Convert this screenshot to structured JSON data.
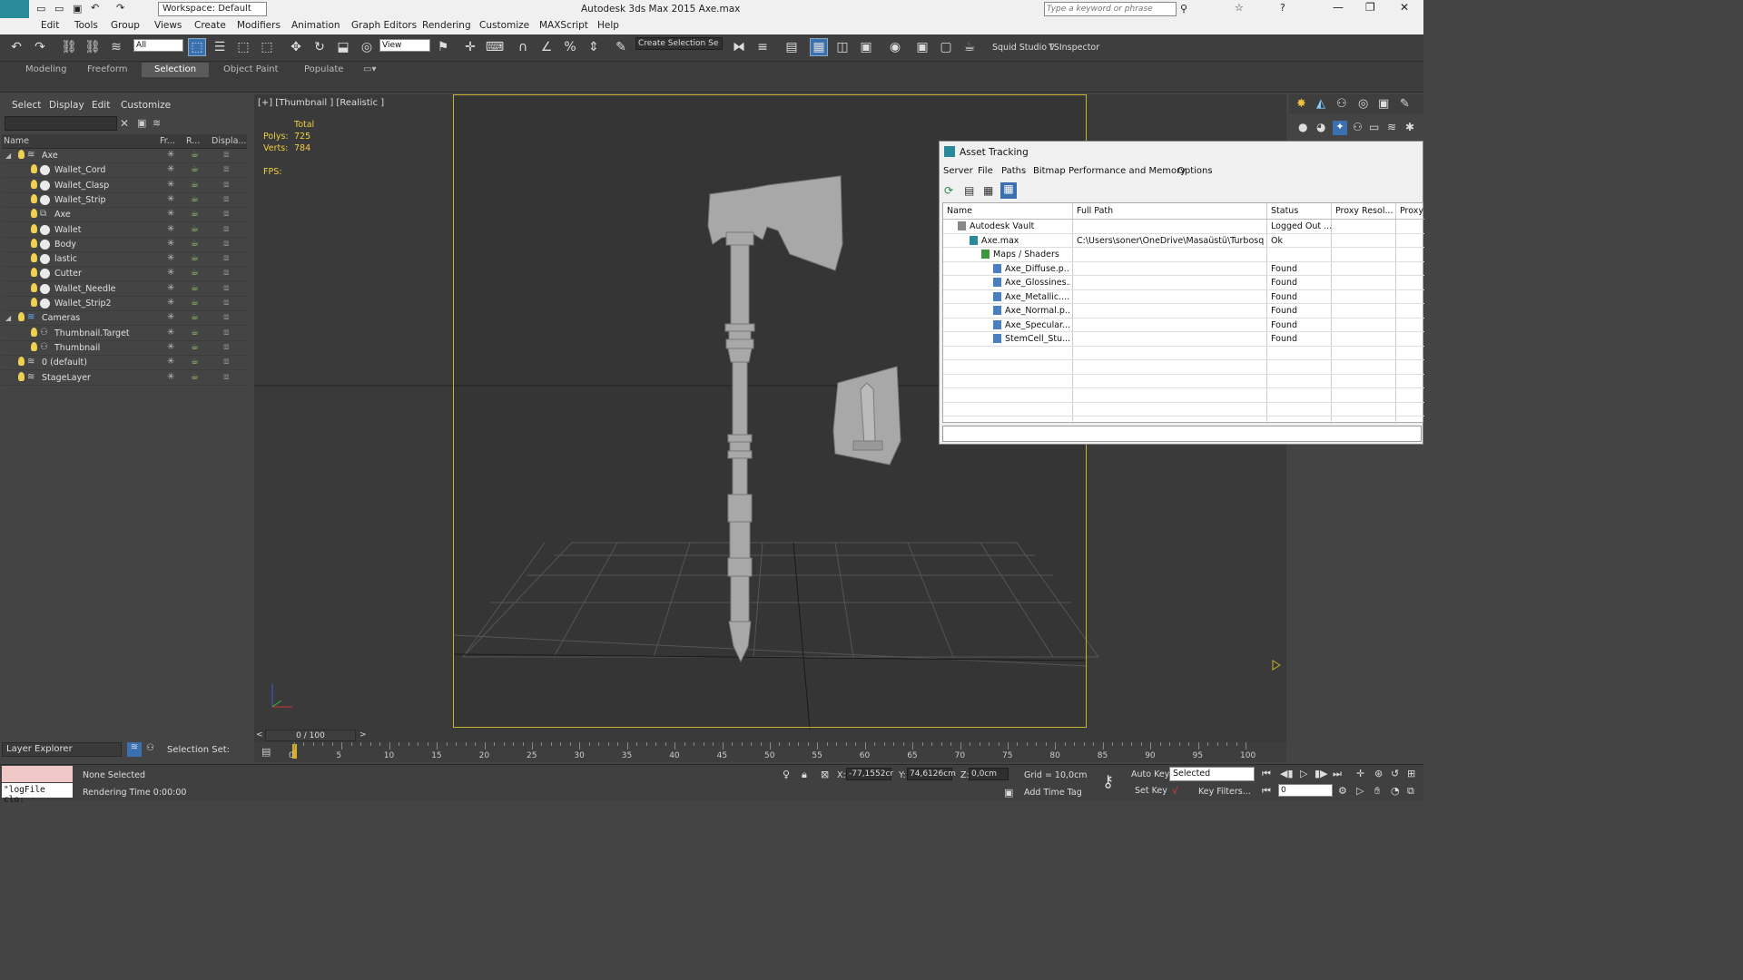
{
  "titlebar": {
    "workspace": "Workspace: Default",
    "title": "Autodesk 3ds Max  2015     Axe.max",
    "search_placeholder": "Type a keyword or phrase"
  },
  "menu": [
    "Edit",
    "Tools",
    "Group",
    "Views",
    "Create",
    "Modifiers",
    "Animation",
    "Graph Editors",
    "Rendering",
    "Customize",
    "MAXScript",
    "Help"
  ],
  "toolbar": {
    "filter": "All",
    "ref_coord": "View",
    "selection_set": "Create Selection Se",
    "plugin1": "Squid Studio v",
    "plugin2": "TSInspector"
  },
  "ribbon_tabs": [
    "Modeling",
    "Freeform",
    "Selection",
    "Object Paint",
    "Populate"
  ],
  "ribbon_selected": "Selection",
  "scene": {
    "menu": [
      "Select",
      "Display",
      "Edit",
      "Customize"
    ],
    "columns": [
      "Name",
      "Fr...",
      "R...",
      "Displa..."
    ],
    "rows": [
      {
        "name": "Axe",
        "level": 0,
        "type": "layer"
      },
      {
        "name": "Wallet_Cord",
        "level": 1,
        "type": "obj"
      },
      {
        "name": "Wallet_Clasp",
        "level": 1,
        "type": "obj"
      },
      {
        "name": "Wallet_Strip",
        "level": 1,
        "type": "obj"
      },
      {
        "name": "Axe",
        "level": 1,
        "type": "group"
      },
      {
        "name": "Wallet",
        "level": 1,
        "type": "obj"
      },
      {
        "name": "Body",
        "level": 1,
        "type": "obj"
      },
      {
        "name": "lastic",
        "level": 1,
        "type": "obj"
      },
      {
        "name": "Cutter",
        "level": 1,
        "type": "obj"
      },
      {
        "name": "Wallet_Needle",
        "level": 1,
        "type": "obj"
      },
      {
        "name": "Wallet_Strip2",
        "level": 1,
        "type": "obj"
      },
      {
        "name": "Cameras",
        "level": 0,
        "type": "layer"
      },
      {
        "name": "Thumbnail.Target",
        "level": 1,
        "type": "cam"
      },
      {
        "name": "Thumbnail",
        "level": 1,
        "type": "cam"
      },
      {
        "name": "0 (default)",
        "level": 0,
        "type": "layer"
      },
      {
        "name": "StageLayer",
        "level": 0,
        "type": "layer"
      }
    ],
    "explorer": "Layer Explorer",
    "selection_set_label": "Selection Set:"
  },
  "viewport": {
    "label": "[+] [Thumbnail ] [Realistic ]",
    "stats": {
      "total": "Total",
      "polys_label": "Polys:",
      "polys": "725",
      "verts_label": "Verts:",
      "verts": "784",
      "fps_label": "FPS:"
    }
  },
  "asset": {
    "title": "Asset Tracking",
    "menu": [
      "Server",
      "File",
      "Paths",
      "Bitmap Performance and Memory",
      "Options"
    ],
    "columns": [
      "Name",
      "Full Path",
      "Status",
      "Proxy Resol...",
      "Proxy"
    ],
    "rows": [
      {
        "name": "Autodesk Vault",
        "path": "",
        "status": "Logged Out ...",
        "indent": 1
      },
      {
        "name": "Axe.max",
        "path": "C:\\Users\\soner\\OneDrive\\Masaüstü\\Turbosq...",
        "status": "Ok",
        "indent": 2
      },
      {
        "name": "Maps / Shaders",
        "path": "",
        "status": "",
        "indent": 3
      },
      {
        "name": "Axe_Diffuse.p...",
        "path": "",
        "status": "Found",
        "indent": 4
      },
      {
        "name": "Axe_Glossines...",
        "path": "",
        "status": "Found",
        "indent": 4
      },
      {
        "name": "Axe_Metallic....",
        "path": "",
        "status": "Found",
        "indent": 4
      },
      {
        "name": "Axe_Normal.p...",
        "path": "",
        "status": "Found",
        "indent": 4
      },
      {
        "name": "Axe_Specular....",
        "path": "",
        "status": "Found",
        "indent": 4
      },
      {
        "name": "StemCell_Stu...",
        "path": "",
        "status": "Found",
        "indent": 4
      }
    ]
  },
  "timeline": {
    "frame": "0 / 100",
    "ticks": [
      "0",
      "5",
      "10",
      "15",
      "20",
      "25",
      "30",
      "35",
      "40",
      "45",
      "50",
      "55",
      "60",
      "65",
      "70",
      "75",
      "80",
      "85",
      "90",
      "95",
      "100"
    ]
  },
  "status": {
    "script": "\"logFile clo:",
    "selected": "None Selected",
    "render_time": "Rendering Time  0:00:00",
    "x_label": "X:",
    "x": "-77,1552cr",
    "y_label": "Y:",
    "y": "74,6126cm",
    "z_label": "Z:",
    "z": "0,0cm",
    "grid": "Grid = 10,0cm",
    "add_time_tag": "Add Time Tag",
    "auto_key": "Auto Key",
    "set_key": "Set Key",
    "key_mode": "Selected",
    "key_filters": "Key Filters...",
    "frame_field": "0"
  }
}
